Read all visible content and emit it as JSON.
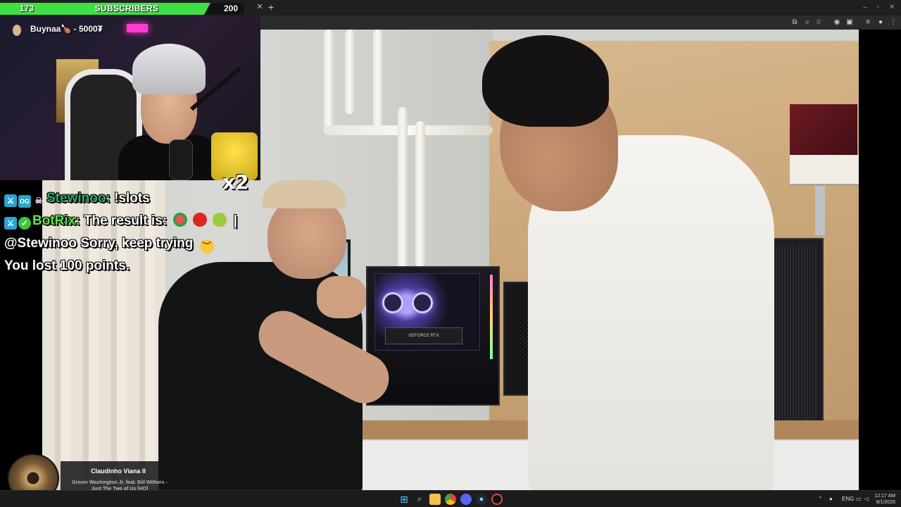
{
  "subscriber_goal": {
    "current": "173",
    "label": "SUBSCRIBERS",
    "target": "200",
    "progress_fraction": 0.865,
    "fill_color": "#3ee043"
  },
  "webcam": {
    "donor_name": "Buynaa",
    "donor_separator": " - ",
    "donor_amount": "5000₮",
    "multiplier_badge": "x2"
  },
  "chat": [
    {
      "badges": [
        "moderator-sword-icon",
        "og-badge-icon",
        "skull-icon"
      ],
      "username": "Stewinoo:",
      "message": "!slots",
      "username_color": "#33a872"
    },
    {
      "badges": [
        "moderator-sword-icon",
        "verified-check-icon"
      ],
      "username": "BotRix:",
      "message": "The result is:",
      "emojis": [
        "watermelon",
        "apple",
        "pear"
      ],
      "separator": "|",
      "username_color": "#5be34e"
    },
    {
      "message": "@Stewinoo Sorry, keep trying",
      "emojis": [
        "pensive-face"
      ]
    },
    {
      "message": "You lost 100 points."
    }
  ],
  "now_playing": {
    "artist": "Claudinho Viana II",
    "track": "Grover Washington Jr. feat. Bill Withers - Just The Two of Us [HQ]"
  },
  "video": {
    "gpu_label": "GEFORCE RTX"
  },
  "taskbar": {
    "apps": [
      "windows-start-icon",
      "search-icon",
      "file-explorer-icon",
      "chrome-icon",
      "discord-icon",
      "steam-icon",
      "obs-icon"
    ],
    "tray_lang": "ENG",
    "clock_time": "12:17 AM",
    "clock_date": "8/1/2025"
  }
}
